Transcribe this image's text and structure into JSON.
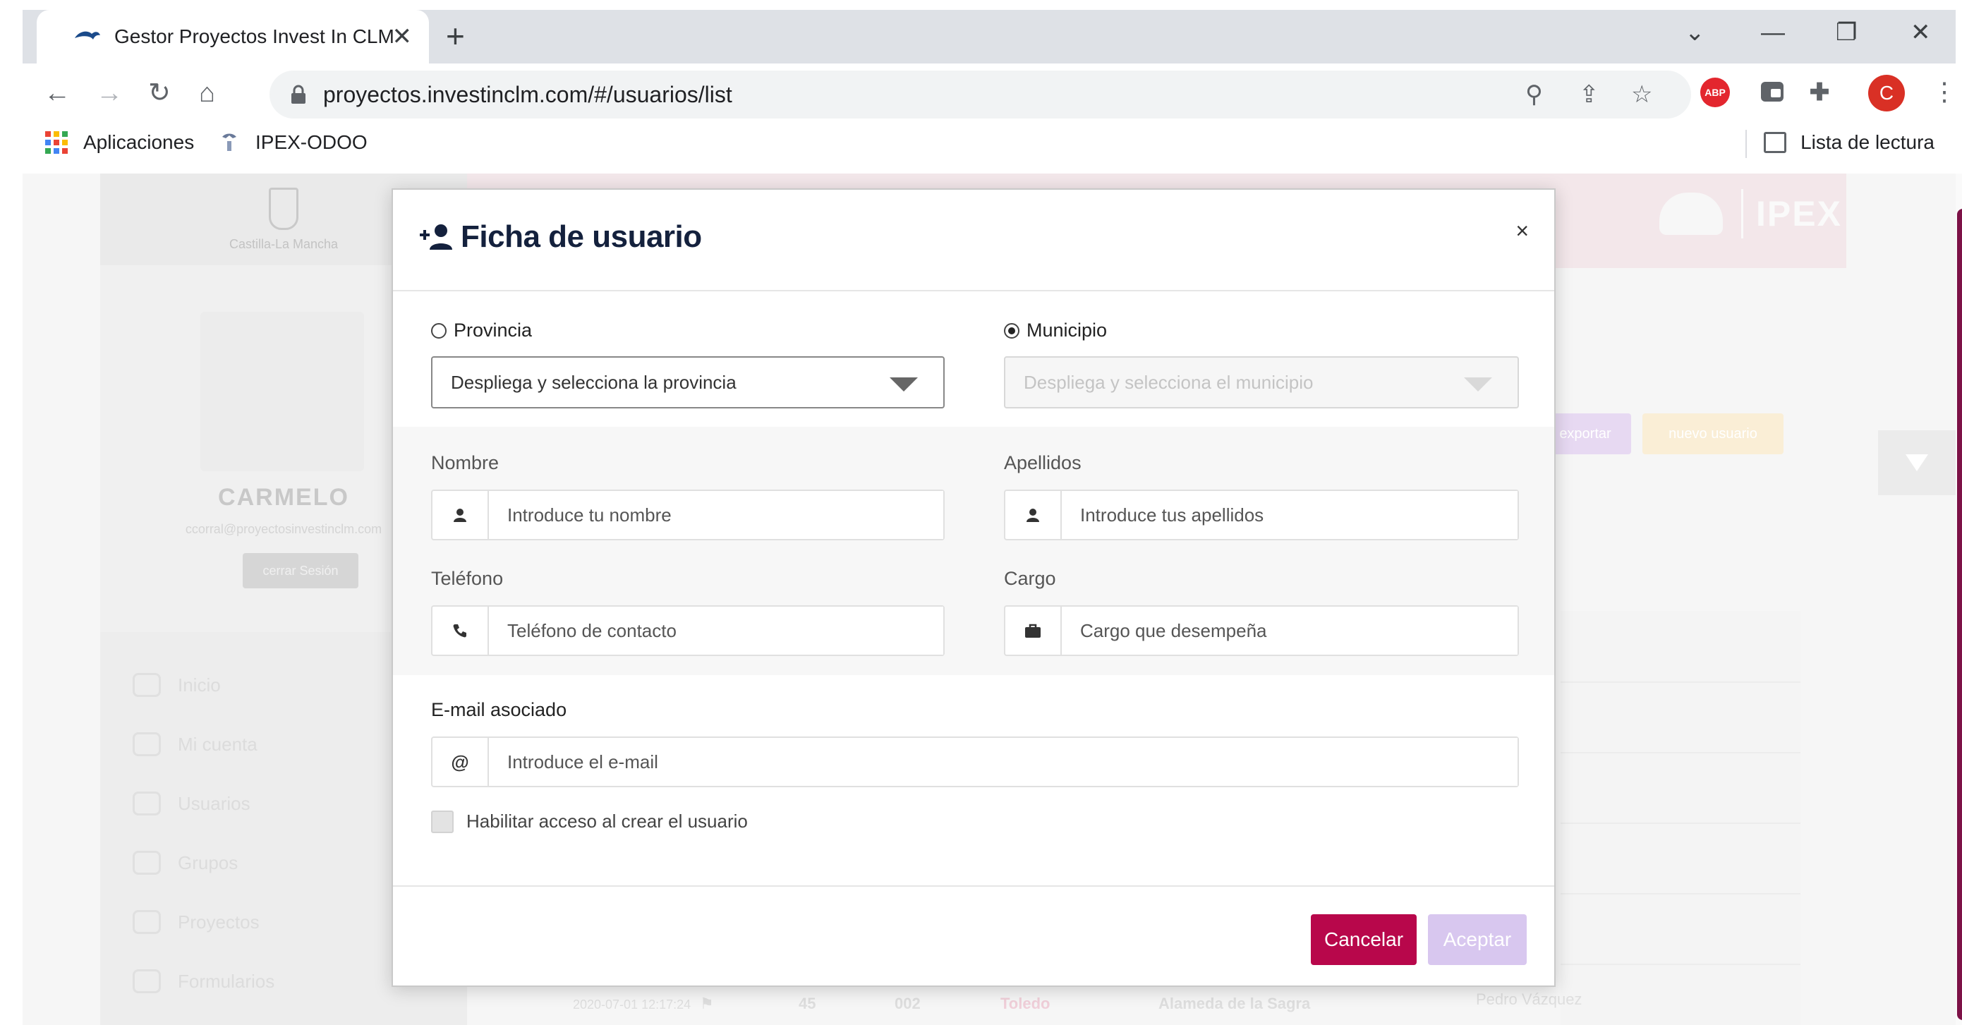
{
  "browser": {
    "tab_title": "Gestor Proyectos Invest In CLM",
    "url": "proyectos.investinclm.com/#/usuarios/list",
    "bookmarks": {
      "apps": "Aplicaciones",
      "ipex": "IPEX-ODOO",
      "reading_list": "Lista de lectura"
    },
    "avatar_letter": "C",
    "ext_abp": "ABP"
  },
  "background": {
    "region_text": "Castilla-La Mancha",
    "profile_name": "CARMELO",
    "profile_email": "ccorral@proyectosinvestinclm.com",
    "logout_label": "cerrar Sesión",
    "menu": [
      "Inicio",
      "Mi cuenta",
      "Usuarios",
      "Grupos",
      "Proyectos",
      "Formularios"
    ],
    "brand": "IPEX",
    "export_label": "exportar",
    "new_user_label": "nuevo usuario",
    "row": {
      "date": "2020-07-01 12:17:24",
      "count": "45",
      "code": "002",
      "province": "Toledo",
      "municipality": "Alameda de la Sagra",
      "person": "Pedro Vázquez"
    }
  },
  "modal": {
    "title": "Ficha de usuario",
    "close": "×",
    "provincia_label": "Provincia",
    "provincia_value": "Despliega y selecciona la provincia",
    "municipio_label": "Municipio",
    "municipio_value": "Despliega y selecciona el municipio",
    "nombre_label": "Nombre",
    "nombre_placeholder": "Introduce tu nombre",
    "apellidos_label": "Apellidos",
    "apellidos_placeholder": "Introduce tus apellidos",
    "telefono_label": "Teléfono",
    "telefono_placeholder": "Teléfono de contacto",
    "cargo_label": "Cargo",
    "cargo_placeholder": "Cargo que desempeña",
    "email_label": "E-mail asociado",
    "email_placeholder": "Introduce el e-mail",
    "checkbox_label": "Habilitar acceso al crear el usuario",
    "cancel_label": "Cancelar",
    "accept_label": "Aceptar"
  },
  "colors": {
    "brand": "#b8074b",
    "accept_disabled": "#d8c7ef",
    "scrollbar": "#7d1247"
  }
}
